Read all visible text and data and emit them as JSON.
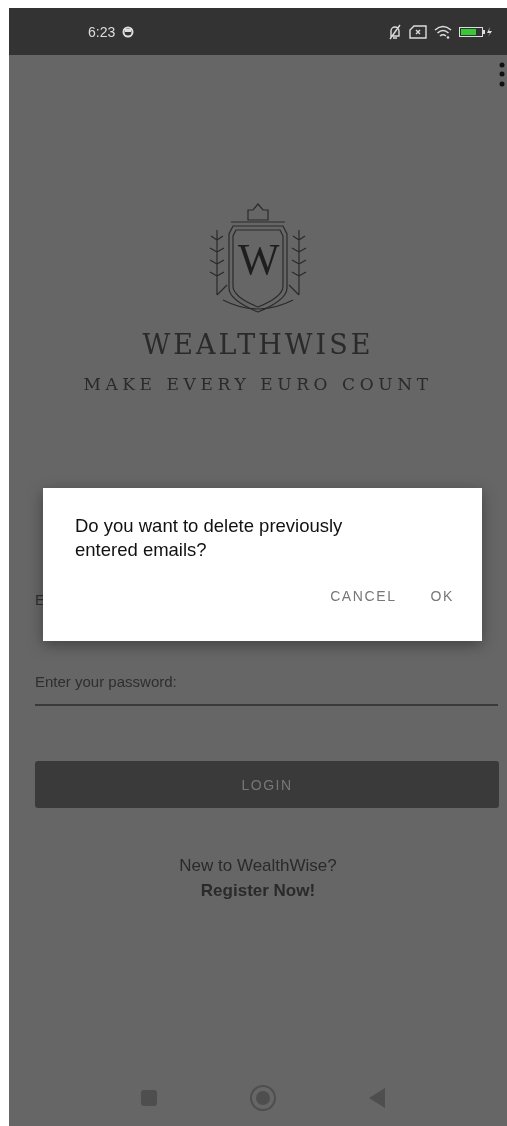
{
  "status_bar": {
    "time": "6:23"
  },
  "logo": {
    "monogram": "W",
    "title": "WEALTHWISE",
    "tagline": "MAKE EVERY EURO COUNT"
  },
  "email_field": {
    "placeholder": "E"
  },
  "password_field": {
    "placeholder": "Enter your password:"
  },
  "login_button": {
    "label": "LOGIN",
    "disabled": true
  },
  "register": {
    "prompt": "New to WealthWise?",
    "link": "Register Now!"
  },
  "dialog": {
    "message": "Do you want to delete previously entered emails?",
    "buttons": [
      {
        "label": "CANCEL"
      },
      {
        "label": "OK"
      }
    ]
  }
}
